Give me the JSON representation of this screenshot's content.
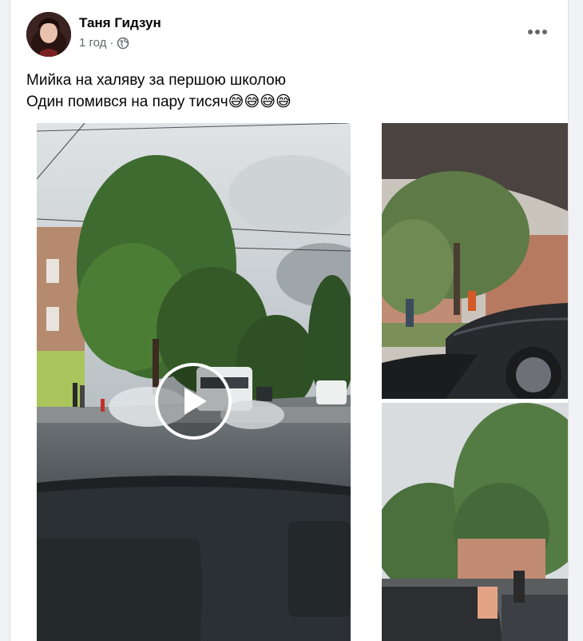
{
  "post": {
    "author": "Таня Гидзун",
    "time": "1 год",
    "separator": "·",
    "privacy_icon": "globe-icon",
    "more_icon": "more-horizontal-icon",
    "text_lines": [
      "Мийка на халяву за першою школою",
      "Один помився на пару тисяч😅😅😅😅"
    ]
  },
  "media": {
    "video_play_icon": "play-icon",
    "photos": [
      "street-video-thumbnail",
      "car-door-photo",
      "trees-photo"
    ]
  },
  "colors": {
    "card": "#ffffff",
    "page": "#f0f2f5",
    "secondary_text": "#65676b",
    "play_button": "#ffffff"
  }
}
